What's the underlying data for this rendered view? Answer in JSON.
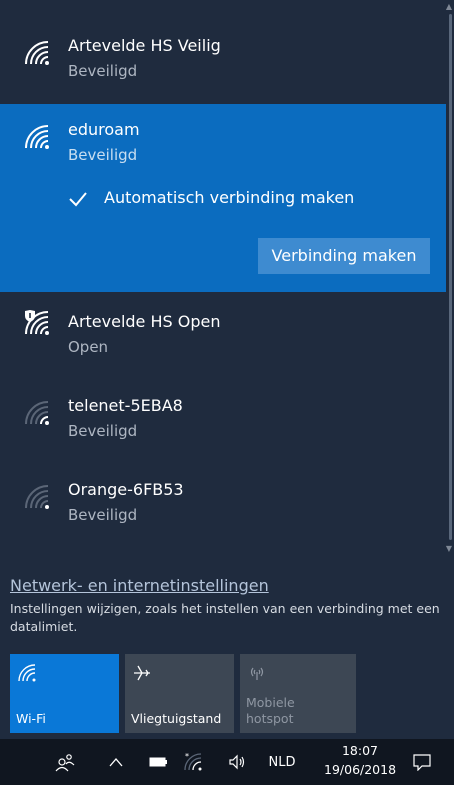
{
  "networks": [
    {
      "name": "Artevelde HS Veilig",
      "status": "Beveiligd",
      "icon": "wifi-signal-strong-icon"
    },
    {
      "name": "eduroam",
      "status": "Beveiligd",
      "icon": "wifi-signal-strong-icon",
      "selected": true
    },
    {
      "name": "Artevelde HS Open",
      "status": "Open",
      "icon": "wifi-open-shield-icon"
    },
    {
      "name": "telenet-5EBA8",
      "status": "Beveiligd",
      "icon": "wifi-signal-weak-icon"
    },
    {
      "name": "Orange-6FB53",
      "status": "Beveiligd",
      "icon": "wifi-signal-weak-icon"
    }
  ],
  "selected_network": {
    "auto_connect_label": "Automatisch verbinding maken",
    "auto_connect_checked": true,
    "connect_button_label": "Verbinding maken"
  },
  "settings": {
    "link_label": "Netwerk- en internetinstellingen",
    "description": "Instellingen wijzigen, zoals het instellen van een verbinding met een datalimiet."
  },
  "quick_actions": [
    {
      "label": "Wi-Fi",
      "icon": "wifi-icon",
      "active": true
    },
    {
      "label": "Vliegtuigstand",
      "icon": "airplane-icon",
      "active": false
    },
    {
      "label": "Mobiele hotspot",
      "icon": "hotspot-icon",
      "disabled": true
    }
  ],
  "taskbar": {
    "language": "NLD",
    "time": "18:07",
    "date": "19/06/2018",
    "icons": [
      "people-icon",
      "chevron-up-icon",
      "battery-icon",
      "wifi-icon",
      "volume-icon",
      "action-center-icon"
    ]
  },
  "colors": {
    "panel_bg": "#1f2b3e",
    "accent": "#0b6cbf",
    "connect_button": "#3e8bd0",
    "taskbar_bg": "#101620"
  }
}
